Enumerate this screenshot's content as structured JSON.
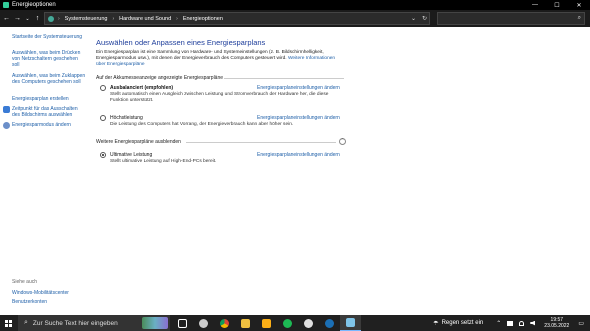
{
  "window": {
    "title": "Energieoptionen",
    "minimize": "—",
    "maximize": "☐",
    "close": "✕"
  },
  "addressbar": {
    "back": "←",
    "forward": "→",
    "recent": "⌄",
    "up": "↑",
    "crumbs": [
      "Systemsteuerung",
      "Hardware und Sound",
      "Energieoptionen"
    ],
    "separator": "›",
    "dropdown": "⌄",
    "refresh": "↻",
    "search_icon": "⌕"
  },
  "sidebar": {
    "home": "Startseite der Systemsteuerung",
    "items": [
      "Auswählen, was beim Drücken von Netzschaltern geschehen soll",
      "Auswählen, was beim Zuklappen des Computers geschehen soll",
      "Energiesparplan erstellen",
      "Zeitpunkt für das Ausschalten des Bildschirms auswählen",
      "Energiesparmodus ändern"
    ],
    "see_also_label": "Siehe auch",
    "see_also": [
      "Windows-Mobilitätscenter",
      "Benutzerkonten"
    ]
  },
  "main": {
    "title": "Auswählen oder Anpassen eines Energiesparplans",
    "intro": "Ein Energiesparplan ist eine Sammlung von Hardware- und Systemeinstellungen (z. B. Bildschirmhelligkeit, Energiesparmodus usw.), mit denen der Energieverbrauch des Computers gesteuert wird. ",
    "intro_link": "Weitere Informationen über Energiesparpläne",
    "section_battery": "Auf der Akkumesseanzeige angezeigte Energiesparpläne",
    "section_hidden": "Weitere Energiesparpläne ausblenden",
    "collapse": "⌃",
    "plans": [
      {
        "name": "Ausbalanciert (empfohlen)",
        "desc": "Stellt automatisch einen Ausgleich zwischen Leistung und Stromverbrauch der Hardware her, die diese Funktion unterstützt.",
        "edit": "Energiesparplaneinstellungen ändern"
      },
      {
        "name": "Höchstleistung",
        "desc": "Die Leistung des Computers hat Vorrang, der Energieverbrauch kann aber höher sein.",
        "edit": "Energiesparplaneinstellungen ändern"
      },
      {
        "name": "Ultimative Leistung",
        "desc": "Stellt ultimative Leistung auf High-End-PCs bereit.",
        "edit": "Energiesparplaneinstellungen ändern",
        "selected": true
      }
    ]
  },
  "taskbar": {
    "search_placeholder": "Zur Suche Text hier eingeben",
    "search_icon": "⌕",
    "apps": [
      "task-view",
      "settings",
      "chrome",
      "file-explorer",
      "rockstar",
      "spotify",
      "security",
      "steam",
      "control-panel"
    ],
    "weather": "Regen setzt ein",
    "weather_icon": "☂",
    "time": "19:57",
    "date": "23.05.2022",
    "chevron": "⌃",
    "notification": "▭"
  }
}
